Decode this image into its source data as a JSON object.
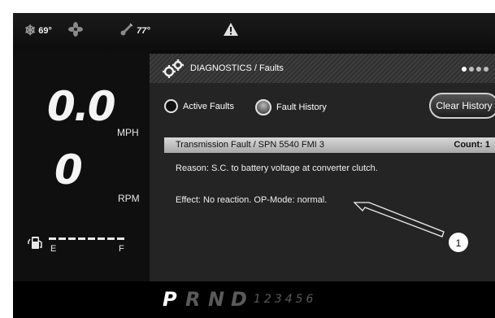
{
  "colors": {
    "screen_bg": "#0a0a0a",
    "panel_bg": "#242424",
    "fault_row_bg": "#c9c9c9",
    "text": "#ffffff",
    "gear_active": "#ffffff",
    "gear_inactive": "#5a5a5a"
  },
  "topbar": {
    "ambient_temp": "69°",
    "coolant_temp": "77°",
    "icons": [
      "snowflake-icon",
      "fan-icon",
      "thermometer-icon",
      "warning-icon"
    ]
  },
  "gauges": {
    "speed": "0.0",
    "speed_unit": "MPH",
    "rpm": "0",
    "rpm_unit": "RPM",
    "fuel_empty_label": "E",
    "fuel_full_label": "F",
    "fuel_icon": "fuel-pump-icon"
  },
  "panel": {
    "title": "DIAGNOSTICS / Faults",
    "title_icon": "gears-icon",
    "page_dots": 4,
    "active_dot": 1,
    "radio_active": "Active Faults",
    "radio_history": "Fault History",
    "selected": "Fault History",
    "clear_button": "Clear History",
    "fault_title": "Transmission Fault / SPN 5540 FMI 3",
    "fault_count": "Count: 1",
    "reason": "Reason: S.C. to battery voltage at converter clutch.",
    "effect": "Effect: No reaction. OP-Mode: normal."
  },
  "gear_selector": {
    "active": "P",
    "letters": [
      "R",
      "N",
      "D"
    ],
    "numbers": "123456"
  },
  "callout": "1"
}
